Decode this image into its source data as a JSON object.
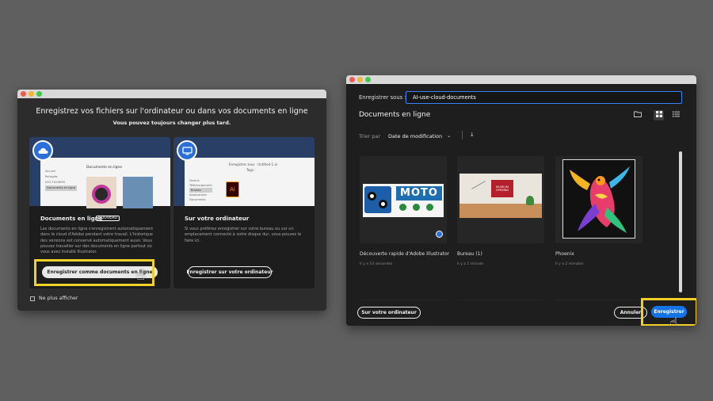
{
  "left_dialog": {
    "title": "Enregistrez vos fichiers sur l'ordinateur ou dans vos documents en ligne",
    "subtitle": "Vous pouvez toujours changer plus tard.",
    "cloud_card": {
      "title": "Documents en ligne",
      "tag": "NOUVEAU",
      "description": "Les documents en ligne s'enregistrent automatiquement dans le cloud d'Adobe pendant votre travail. L'historique des versions est conservé automatiquement aussi. Vous pouvez travailler sur des documents en ligne partout où vous avez installé Illustrator.",
      "button": "Enregistrer comme documents en ligne",
      "preview_sidebar": [
        "Accueil",
        "Partagés",
        "VOS FICHIERS",
        "Documents en ligne"
      ],
      "preview_heading": "Documents en ligne"
    },
    "local_card": {
      "title": "Sur votre ordinateur",
      "description": "Si vous préférez enregistrer sur votre bureau ou sur un emplacement connecté à votre disque dur, vous pouvez le faire ici.",
      "button": "Enregistrer sur votre ordinateur",
      "preview_sidebar": [
        "Favoris",
        "Téléchargement",
        "Bureau",
        "Applications",
        "Documents"
      ],
      "preview_field": "Enregistrer sous : Untitled-1.ai",
      "preview_tags": "Tags :",
      "preview_file": "Ai"
    },
    "dont_show": "Ne plus afficher"
  },
  "right_dialog": {
    "save_as_label": "Enregistrer sous :",
    "filename": "AI-use-cloud-documents",
    "location_title": "Documents en ligne",
    "sort_label": "Trier par",
    "sort_value": "Date de modification",
    "sort_direction": "↓",
    "files": [
      {
        "name": "Découverte rapide d'Adobe Illustrator",
        "time": "Il y a 53 secondes",
        "thumb_text": "MOTO"
      },
      {
        "name": "Bureau (1)",
        "time": "Il y a 1 minute",
        "thumb_text": "MUSEUM OPENING"
      },
      {
        "name": "Phoenix",
        "time": "Il y a 2 minutes",
        "thumb_text": ""
      }
    ],
    "local_button": "Sur votre ordinateur",
    "cancel_button": "Annuler",
    "save_button": "Enregistrer"
  },
  "colors": {
    "highlight": "#f2d027",
    "accent_blue": "#1473e6"
  }
}
